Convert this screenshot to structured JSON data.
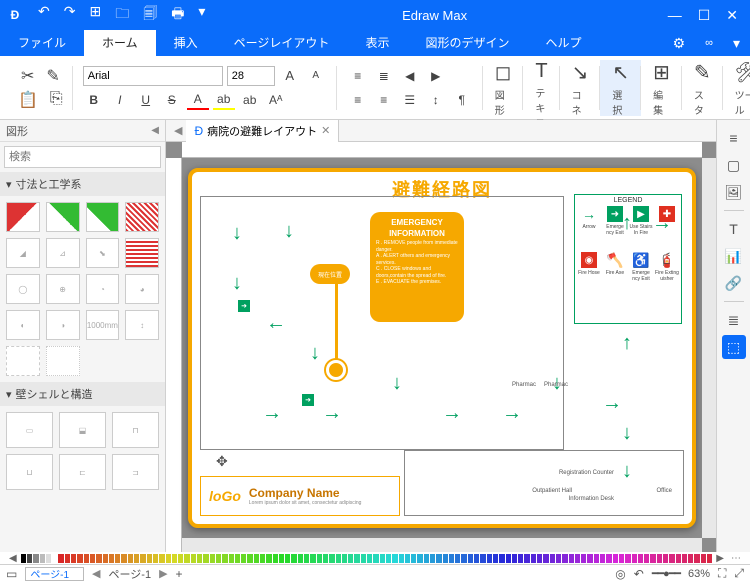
{
  "app": {
    "title": "Edraw Max"
  },
  "qat": {
    "undo_tip": "↶",
    "redo_tip": "↷",
    "new": "⊞",
    "open": "🗀",
    "save": "🗐",
    "print": "🖶",
    "more": "▾"
  },
  "win": {
    "min": "—",
    "max": "☐",
    "close": "✕"
  },
  "menu": {
    "file": "ファイル",
    "home": "ホーム",
    "insert": "挿入",
    "page_layout": "ページレイアウト",
    "view": "表示",
    "design": "図形のデザイン",
    "help": "ヘルプ",
    "settings": "⚙",
    "collapse": "✕"
  },
  "ribbon": {
    "clipboard_cut": "✂",
    "clipboard_copy": "⎘",
    "clipboard_brush": "✎",
    "clipboard_paste": "📋",
    "font_name": "Arial",
    "font_size": "28",
    "inc": "A",
    "dec": "A",
    "bold": "B",
    "italic": "I",
    "underline": "U",
    "strike": "S",
    "color": "A",
    "highlight": "ab",
    "abc": "ab",
    "sigma": "A",
    "case": "Aᴬ",
    "bullets": "≡",
    "numbers": "≣",
    "indent_dec": "◀",
    "indent_inc": "▶",
    "align_l": "≡",
    "align_c": "≡",
    "align_r": "☰",
    "spacing": "↕",
    "para_l": "¶",
    "shape": "図形",
    "text": "テキスト",
    "connector": "コネクタ",
    "select": "選択",
    "edit": "編集",
    "style": "スタイル",
    "tool": "ツール"
  },
  "left": {
    "title": "図形",
    "search_ph": "検索",
    "section1": "寸法と工学系",
    "section2": "壁シェルと構造",
    "dim_label": "1000mm"
  },
  "doc": {
    "tab_name": "病院の避難レイアウト"
  },
  "page": {
    "title": "避難経路図",
    "legend_title": "LEGEND",
    "legend_items": [
      {
        "icon": "→",
        "cls": "green",
        "label": "Arrow"
      },
      {
        "icon": "➜",
        "cls": "box-g",
        "label": "Emerge ncy Exit"
      },
      {
        "icon": "▶",
        "cls": "box-g",
        "label": "Use Stairs In Fire"
      },
      {
        "icon": "✚",
        "cls": "box-r",
        "label": ""
      },
      {
        "icon": "◉",
        "cls": "box-r",
        "label": "Fire Hose"
      },
      {
        "icon": "🪓",
        "cls": "red",
        "label": "Fire Axe"
      },
      {
        "icon": "♿",
        "cls": "green",
        "label": "Emerge ncy Exit"
      },
      {
        "icon": "🧯",
        "cls": "red",
        "label": "Fire Exting uisher"
      }
    ],
    "emerg_h1": "EMERGENCY",
    "emerg_h2": "INFORMATION",
    "emerg_body": "R . REMOVE people from immediate danger.\nA . ALERT others and emergency services.\nC . CLOSE windows and doors,contain the spread of fire.\nE . EVACUATE the premises.",
    "current_loc": "現在位置",
    "company": "Company Name",
    "lorem": "Lorem ipsum dolor sit amet, consectetur adipiscing",
    "outpatient": "Outpatient Hall",
    "reg": "Registration Counter",
    "info": "Information Desk",
    "pharmacy": "Pharmac",
    "office": "Office"
  },
  "status": {
    "page_sel": "ページ-1",
    "page_label": "ページ-1",
    "add": "+",
    "target": "◎",
    "rollback": "↶",
    "slider": "━━●━━",
    "zoom": "63%",
    "fit": "⛶",
    "full": "⤢"
  },
  "right_tools": [
    "≡",
    "▢",
    "🖼",
    "T",
    "📊",
    "🔗",
    "≣",
    "⬚"
  ]
}
